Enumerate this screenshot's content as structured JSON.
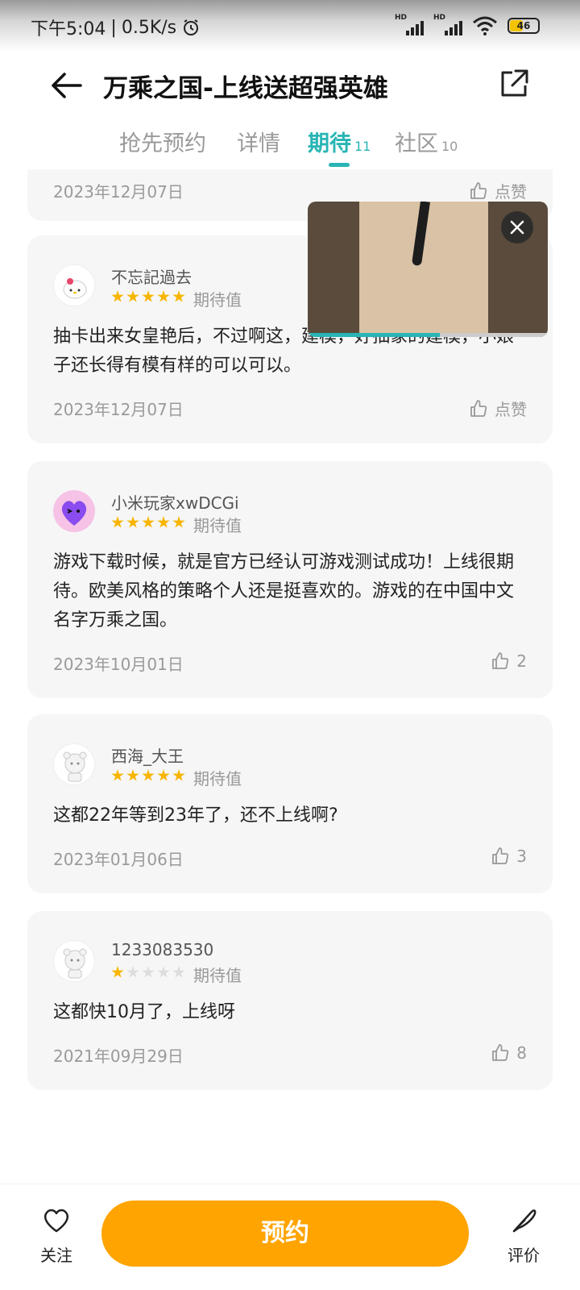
{
  "status_bar": {
    "time": "下午5:04",
    "net_speed": "0.5K/s",
    "battery": "46",
    "signal_label": "HD"
  },
  "header": {
    "title": "万乘之国-上线送超强英雄"
  },
  "tabs": [
    {
      "label": "抢先预约",
      "count": ""
    },
    {
      "label": "详情",
      "count": ""
    },
    {
      "label": "期待",
      "count": "11"
    },
    {
      "label": "社区",
      "count": "10"
    }
  ],
  "reviews": [
    {
      "date": "2023年12月07日",
      "like": "点赞"
    },
    {
      "name": "不忘記過去",
      "stars": 5,
      "expect_label": "期待值",
      "text": "抽卡出来女皇艳后，不过啊这，建模，好抽象的建模，小娘子还长得有模有样的可以可以。",
      "date": "2023年12月07日",
      "like": "点赞"
    },
    {
      "name": "小米玩家xwDCGi",
      "stars": 5,
      "expect_label": "期待值",
      "text": "游戏下载时候，就是官方已经认可游戏测试成功！上线很期待。欧美风格的策略个人还是挺喜欢的。游戏的在中国中文名字万乘之国。",
      "date": "2023年10月01日",
      "like": "2"
    },
    {
      "name": "西海_大王",
      "stars": 5,
      "expect_label": "期待值",
      "text": "这都22年等到23年了，还不上线啊?",
      "date": "2023年01月06日",
      "like": "3"
    },
    {
      "name": "1233083530",
      "stars": 1,
      "expect_label": "期待值",
      "text": "这都快10月了，上线呀",
      "date": "2021年09月29日",
      "like": "8"
    }
  ],
  "bottom": {
    "follow_label": "关注",
    "reserve_label": "预约",
    "rate_label": "评价"
  },
  "colors": {
    "accent": "#29b5b5",
    "primary_button": "#ffa400",
    "star": "#f8b500"
  }
}
